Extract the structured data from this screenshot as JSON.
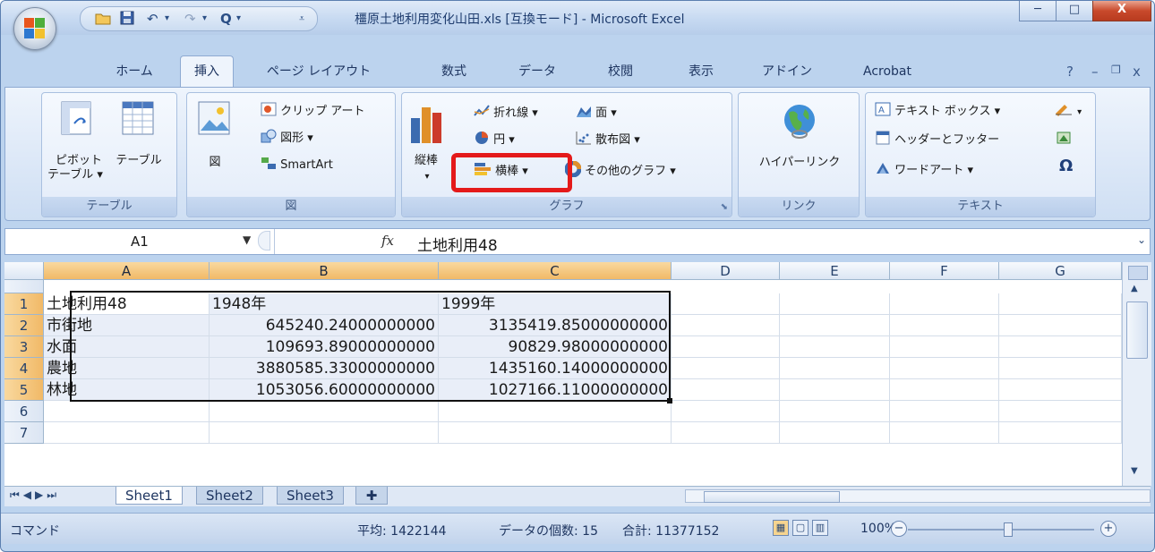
{
  "window": {
    "title": "橿原土地利用変化山田.xls  [互換モード] - Microsoft Excel",
    "minimize": "─",
    "maximize": "□",
    "close": "X"
  },
  "qat": {
    "save_icon": "save-icon",
    "undo": "↶",
    "redo": "↷",
    "preview": "Q"
  },
  "tabs": [
    "ホーム",
    "挿入",
    "ページ レイアウト",
    "数式",
    "データ",
    "校閲",
    "表示",
    "アドイン",
    "Acrobat"
  ],
  "active_tab": "挿入",
  "ribbon": {
    "table_group": {
      "label": "テーブル",
      "pivot_label_1": "ピボット",
      "pivot_label_2": "テーブル ▾",
      "table_label": "テーブル"
    },
    "illust_group": {
      "label": "図",
      "picture_label": "図",
      "clipart": "クリップ アート",
      "shapes": "図形 ▾",
      "smartart": "SmartArt"
    },
    "chart_group": {
      "label": "グラフ",
      "column_label": "縦棒",
      "line": "折れ線 ▾",
      "area": "面 ▾",
      "pie": "円 ▾",
      "scatter": "散布図 ▾",
      "bar": "横棒 ▾",
      "other": "その他のグラフ ▾"
    },
    "link_group": {
      "label": "リンク",
      "hyperlink": "ハイパーリンク"
    },
    "text_group": {
      "label": "テキスト",
      "textbox": "テキスト ボックス ▾",
      "header_footer": "ヘッダーとフッター",
      "wordart": "ワードアート ▾",
      "symbol": "Ω"
    }
  },
  "formula_bar": {
    "name_box": "A1",
    "fx": "fx",
    "content": "土地利用48"
  },
  "sheet": {
    "columns": [
      "A",
      "B",
      "C",
      "D",
      "E",
      "F",
      "G"
    ],
    "rows": [
      "1",
      "2",
      "3",
      "4",
      "5",
      "6",
      "7"
    ],
    "cells": [
      [
        "土地利用48",
        "1948年",
        "1999年"
      ],
      [
        "市街地",
        "645240.24000000000",
        "3135419.85000000000"
      ],
      [
        "水面",
        "109693.89000000000",
        "90829.98000000000"
      ],
      [
        "農地",
        "3880585.33000000000",
        "1435160.14000000000"
      ],
      [
        "林地",
        "1053056.60000000000",
        "1027166.11000000000"
      ]
    ]
  },
  "sheet_tabs": [
    "Sheet1",
    "Sheet2",
    "Sheet3"
  ],
  "status": {
    "mode": "コマンド",
    "average": "平均: 1422144",
    "count": "データの個数: 15",
    "sum": "合計: 11377152",
    "zoom": "100%"
  }
}
